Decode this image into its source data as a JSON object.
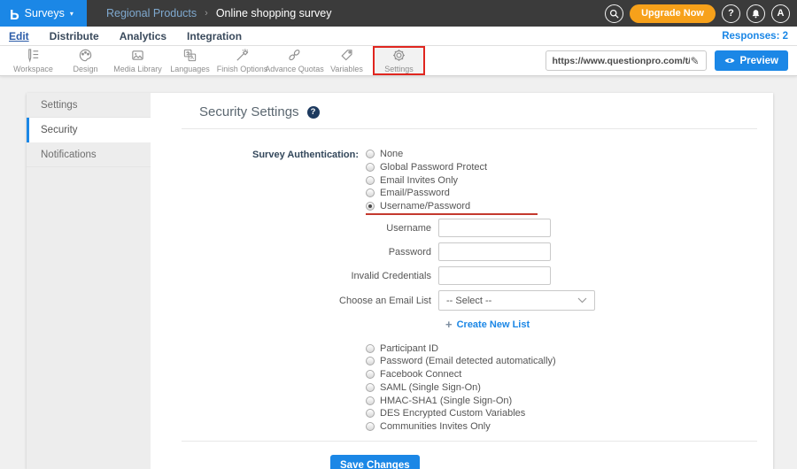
{
  "topbar": {
    "logo_letter": "P",
    "product": "Surveys",
    "caret": "▾",
    "breadcrumb": {
      "parent": "Regional Products",
      "separator": "›",
      "current": "Online shopping survey"
    },
    "upgrade_label": "Upgrade Now",
    "help_label": "?",
    "avatar_label": "A"
  },
  "nav": {
    "tabs": [
      {
        "label": "Edit"
      },
      {
        "label": "Distribute"
      },
      {
        "label": "Analytics"
      },
      {
        "label": "Integration"
      }
    ],
    "active_tab": "Edit",
    "responses": "Responses: 2"
  },
  "toolbar": {
    "items": [
      {
        "label": "Workspace"
      },
      {
        "label": "Design"
      },
      {
        "label": "Media Library"
      },
      {
        "label": "Languages"
      },
      {
        "label": "Finish Options"
      },
      {
        "label": "Advance Quotas"
      },
      {
        "label": "Variables"
      },
      {
        "label": "Settings",
        "highlighted": true
      }
    ],
    "url_value": "https://www.questionpro.com/t/APNrFZ",
    "pencil_glyph": "✎",
    "preview_label": "Preview"
  },
  "sidebar": {
    "items": [
      {
        "label": "Settings"
      },
      {
        "label": "Security"
      },
      {
        "label": "Notifications"
      }
    ],
    "active": "Security"
  },
  "main": {
    "title": "Security Settings",
    "help_glyph": "?",
    "auth": {
      "label": "Survey Authentication:",
      "options_top": [
        "None",
        "Global Password Protect",
        "Email Invites Only",
        "Email/Password",
        "Username/Password"
      ],
      "selected": "Username/Password",
      "options_bottom": [
        "Participant ID",
        "Password (Email detected automatically)",
        "Facebook Connect",
        "SAML (Single Sign-On)",
        "HMAC-SHA1 (Single Sign-On)",
        "DES Encrypted Custom Variables",
        "Communities Invites Only"
      ]
    },
    "fields": {
      "username": {
        "label": "Username",
        "value": ""
      },
      "password": {
        "label": "Password",
        "value": ""
      },
      "invalid_credentials": {
        "label": "Invalid Credentials",
        "value": ""
      },
      "email_list": {
        "label": "Choose an Email List",
        "selected_value": "-- Select --"
      }
    },
    "create_plus": "+",
    "create_new_list_label": "Create New List",
    "save_label": "Save Changes"
  },
  "colors": {
    "brand_blue": "#1b87e6",
    "topbar_dark": "#3b3b3b",
    "upgrade_orange": "#f7a11a",
    "annotation_red": "#e0261f",
    "underline_red": "#c4392e",
    "link_blue": "#1b87e6"
  }
}
